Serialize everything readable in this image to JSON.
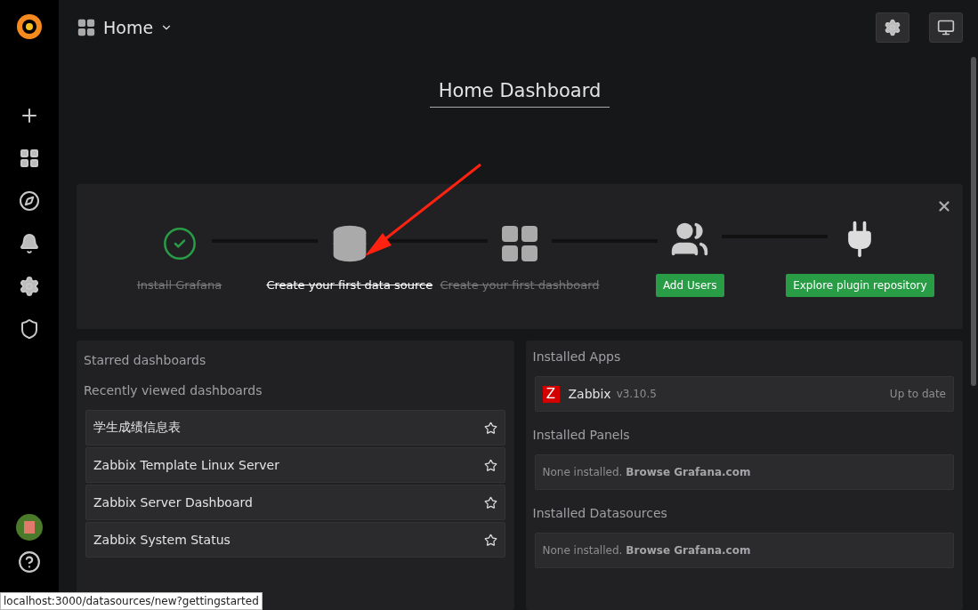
{
  "topbar": {
    "title": "Home"
  },
  "dashboard": {
    "title": "Home Dashboard"
  },
  "getting_started": {
    "steps": [
      {
        "kind": "link",
        "label": "Install Grafana",
        "done": true,
        "active": false
      },
      {
        "kind": "link",
        "label": "Create your first data source",
        "done": true,
        "active": true
      },
      {
        "kind": "link",
        "label": "Create your first dashboard",
        "done": true,
        "active": false
      },
      {
        "kind": "button",
        "label": "Add Users",
        "done": false,
        "active": false
      },
      {
        "kind": "button",
        "label": "Explore plugin repository",
        "done": false,
        "active": false
      }
    ]
  },
  "starred": {
    "title": "Starred dashboards"
  },
  "recent": {
    "title": "Recently viewed dashboards",
    "items": [
      {
        "name": "学生成绩信息表",
        "starred": false
      },
      {
        "name": "Zabbix Template Linux Server",
        "starred": false
      },
      {
        "name": "Zabbix Server Dashboard",
        "starred": false
      },
      {
        "name": "Zabbix System Status",
        "starred": false
      }
    ]
  },
  "plugins": [
    {
      "kind": "apps",
      "title": "Installed Apps",
      "items": [
        {
          "logo": "Z",
          "name": "Zabbix",
          "version": "v3.10.5",
          "status": "Up to date"
        }
      ]
    },
    {
      "kind": "empty",
      "title": "Installed Panels",
      "text": "None installed.",
      "link": "Browse Grafana.com"
    },
    {
      "kind": "empty",
      "title": "Installed Datasources",
      "text": "None installed.",
      "link": "Browse Grafana.com"
    }
  ],
  "status_url": "localhost:3000/datasources/new?gettingstarted"
}
